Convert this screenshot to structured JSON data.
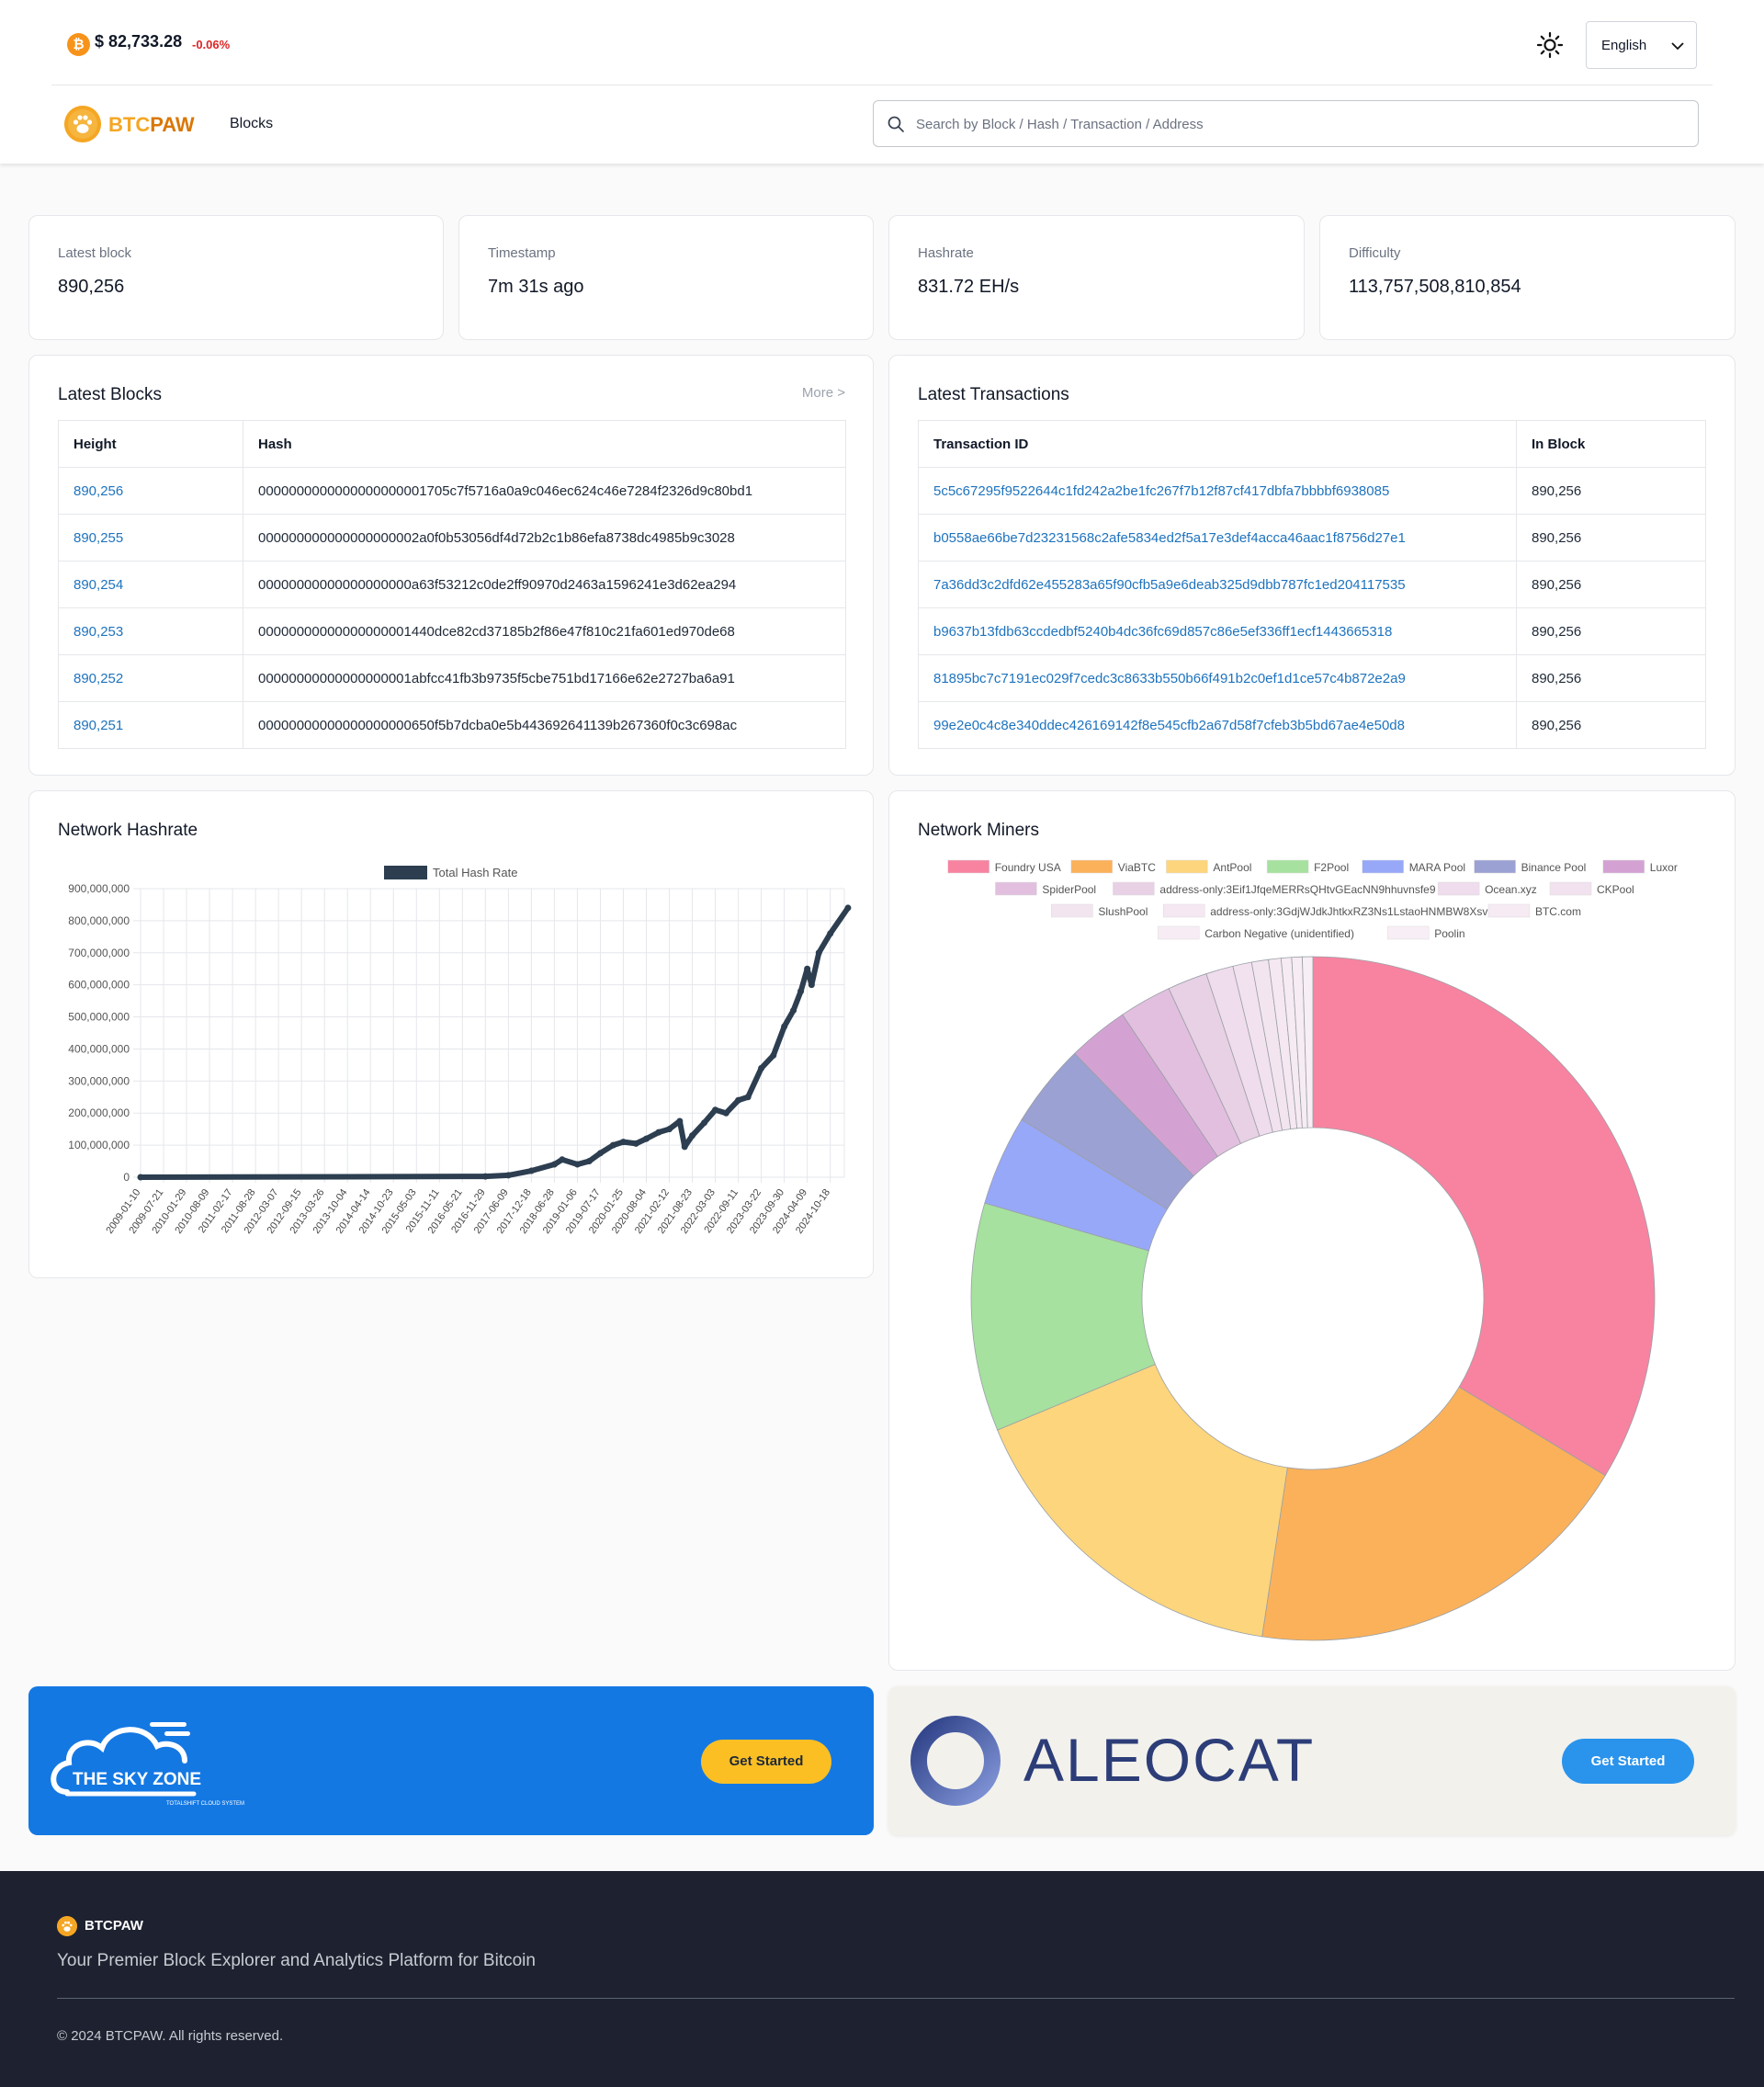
{
  "topbar": {
    "btc_price": "$ 82,733.28",
    "btc_change": "-0.06%",
    "language": "English"
  },
  "nav": {
    "logo_part1": "BTC",
    "logo_part2": "PAW",
    "blocks_link": "Blocks",
    "search_placeholder": "Search by Block / Hash / Transaction / Address"
  },
  "stats": [
    {
      "label": "Latest block",
      "value": "890,256"
    },
    {
      "label": "Timestamp",
      "value": "7m 31s ago"
    },
    {
      "label": "Hashrate",
      "value": "831.72 EH/s"
    },
    {
      "label": "Difficulty",
      "value": "113,757,508,810,854"
    }
  ],
  "latest_blocks": {
    "title": "Latest Blocks",
    "more": "More >",
    "headers": [
      "Height",
      "Hash"
    ],
    "rows": [
      {
        "height": "890,256",
        "hash": "0000000000000000000001705c7f5716a0a9c046ec624c46e7284f2326d9c80bd1"
      },
      {
        "height": "890,255",
        "hash": "000000000000000000002a0f0b53056df4d72b2c1b86efa8738dc4985b9c3028"
      },
      {
        "height": "890,254",
        "hash": "00000000000000000000a63f53212c0de2ff90970d2463a1596241e3d62ea294"
      },
      {
        "height": "890,253",
        "hash": "00000000000000000001440dce82cd37185b2f86e47f810c21fa601ed970de68"
      },
      {
        "height": "890,252",
        "hash": "00000000000000000001abfcc41fb3b9735f5cbe751bd17166e62e2727ba6a91"
      },
      {
        "height": "890,251",
        "hash": "00000000000000000000650f5b7dcba0e5b443692641139b267360f0c3c698ac"
      }
    ]
  },
  "latest_transactions": {
    "title": "Latest Transactions",
    "headers": [
      "Transaction ID",
      "In Block"
    ],
    "rows": [
      {
        "txid": "5c5c67295f9522644c1fd242a2be1fc267f7b12f87cf417dbfa7bbbbf6938085",
        "block": "890,256"
      },
      {
        "txid": "b0558ae66be7d23231568c2afe5834ed2f5a17e3def4acca46aac1f8756d27e1",
        "block": "890,256"
      },
      {
        "txid": "7a36dd3c2dfd62e455283a65f90cfb5a9e6deab325d9dbb787fc1ed204117535",
        "block": "890,256"
      },
      {
        "txid": "b9637b13fdb63ccdedbf5240b4dc36fc69d857c86e5ef336ff1ecf1443665318",
        "block": "890,256"
      },
      {
        "txid": "81895bc7c7191ec029f7cedc3c8633b550b66f491b2c0ef1d1ce57c4b872e2a9",
        "block": "890,256"
      },
      {
        "txid": "99e2e0c4c8e340ddec426169142f8e545cfb2a67d58f7cfeb3b5bd67ae4e50d8",
        "block": "890,256"
      }
    ]
  },
  "hashrate_card_title": "Network Hashrate",
  "miners_card_title": "Network Miners",
  "chart_data": [
    {
      "type": "line",
      "legend": [
        "Total Hash Rate"
      ],
      "ylim": [
        0,
        900000000
      ],
      "y_ticks": [
        "0",
        "100,000,000",
        "200,000,000",
        "300,000,000",
        "400,000,000",
        "500,000,000",
        "600,000,000",
        "700,000,000",
        "800,000,000",
        "900,000,000"
      ],
      "x_ticks": [
        "2009-01-10",
        "2009-07-21",
        "2010-01-29",
        "2010-08-09",
        "2011-02-17",
        "2011-08-28",
        "2012-03-07",
        "2012-09-15",
        "2013-03-26",
        "2013-10-04",
        "2014-04-14",
        "2014-10-23",
        "2015-05-03",
        "2015-11-11",
        "2016-05-21",
        "2016-11-29",
        "2017-06-09",
        "2017-12-18",
        "2018-06-28",
        "2019-01-06",
        "2019-07-17",
        "2020-01-25",
        "2020-08-04",
        "2021-02-12",
        "2021-08-23",
        "2022-03-03",
        "2022-09-11",
        "2023-03-22",
        "2023-09-30",
        "2024-04-09",
        "2024-10-18"
      ],
      "series": [
        {
          "name": "Total Hash Rate",
          "color": "#2c3e50",
          "x": [
            "2009-01-10",
            "2016-11-29",
            "2017-06-09",
            "2017-12-18",
            "2018-06-28",
            "2018-09-01",
            "2019-01-06",
            "2019-04-15",
            "2019-07-17",
            "2019-11-01",
            "2020-01-25",
            "2020-05-10",
            "2020-08-04",
            "2020-11-15",
            "2021-02-12",
            "2021-05-10",
            "2021-06-20",
            "2021-08-23",
            "2021-12-01",
            "2022-03-03",
            "2022-06-01",
            "2022-09-11",
            "2022-12-01",
            "2023-03-22",
            "2023-07-01",
            "2023-09-30",
            "2023-12-15",
            "2024-02-15",
            "2024-04-09",
            "2024-05-15",
            "2024-07-15",
            "2024-10-18",
            "2025-03-15"
          ],
          "values": [
            0,
            2500000,
            6000000,
            20000000,
            40000000,
            55000000,
            40000000,
            50000000,
            75000000,
            100000000,
            110000000,
            105000000,
            120000000,
            140000000,
            150000000,
            175000000,
            95000000,
            130000000,
            170000000,
            210000000,
            200000000,
            240000000,
            250000000,
            340000000,
            380000000,
            470000000,
            520000000,
            580000000,
            650000000,
            600000000,
            700000000,
            760000000,
            840000000
          ]
        }
      ]
    },
    {
      "type": "pie",
      "series": [
        {
          "name": "Foundry USA",
          "value": 34.0,
          "color": "#f783a0"
        },
        {
          "name": "ViaBTC",
          "value": 18.9,
          "color": "#fbb15a"
        },
        {
          "name": "AntPool",
          "value": 16.5,
          "color": "#fdd57c"
        },
        {
          "name": "F2Pool",
          "value": 10.9,
          "color": "#a6e19f"
        },
        {
          "name": "MARA Pool",
          "value": 4.3,
          "color": "#97a8f8"
        },
        {
          "name": "Binance Pool",
          "value": 4.0,
          "color": "#9ba1d2"
        },
        {
          "name": "Luxor",
          "value": 2.9,
          "color": "#d3a2d3"
        },
        {
          "name": "SpiderPool",
          "value": 2.5,
          "color": "#e2bfdf"
        },
        {
          "name": "address-only:3Eif1JfqeMERRsQHtvGEacNN9hhuvnsfe9",
          "value": 1.9,
          "color": "#e8d0e5"
        },
        {
          "name": "Ocean.xyz",
          "value": 1.3,
          "color": "#efdcec"
        },
        {
          "name": "CKPool",
          "value": 0.9,
          "color": "#f2e2ef"
        },
        {
          "name": "SlushPool",
          "value": 0.8,
          "color": "#f3e5f0"
        },
        {
          "name": "address-only:3GdjWJdkJhtkxRZ3Ns1LstaoHNMBW8XsvU",
          "value": 0.6,
          "color": "#f5e8f2"
        },
        {
          "name": "BTC.com",
          "value": 0.5,
          "color": "#f6eaf3"
        },
        {
          "name": "Carbon Negative (unidentified)",
          "value": 0.5,
          "color": "#f7ecf4"
        },
        {
          "name": "Poolin",
          "value": 0.5,
          "color": "#f8eef5"
        }
      ]
    }
  ],
  "banners": {
    "sky_brand": "THE SKY ZONE",
    "sky_tagline": "TOTALSHIFT CLOUD SYSTEM",
    "sky_button": "Get Started",
    "aleo_brand": "ALEOCAT",
    "aleo_button": "Get Started"
  },
  "footer": {
    "brand": "BTCPAW",
    "tagline": "Your Premier Block Explorer and Analytics Platform for Bitcoin",
    "copyright": "© 2024 BTCPAW. All rights reserved."
  },
  "colors": {
    "accent": "#f5a623",
    "link": "#1e73be",
    "negative": "#dc2626",
    "footer_bg": "#1e2230"
  }
}
